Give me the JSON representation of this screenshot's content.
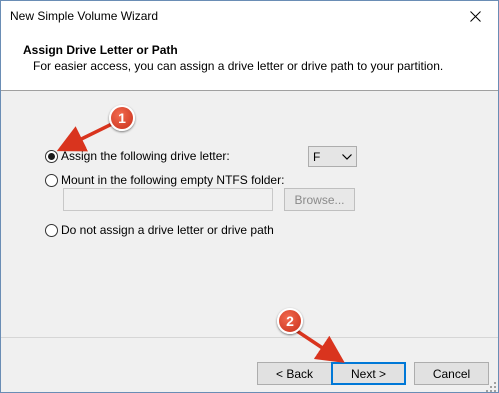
{
  "window": {
    "title": "New Simple Volume Wizard",
    "close_glyph": "✕"
  },
  "header": {
    "title": "Assign Drive Letter or Path",
    "subtitle": "For easier access, you can assign a drive letter or drive path to your partition."
  },
  "options": {
    "assign_letter": {
      "label": "Assign the following drive letter:",
      "checked": true
    },
    "mount_folder": {
      "label": "Mount in the following empty NTFS folder:",
      "checked": false
    },
    "no_letter": {
      "label": "Do not assign a drive letter or drive path",
      "checked": false
    }
  },
  "drive_letter": {
    "value": "F",
    "arrow_glyph": "⌄"
  },
  "folder_path": {
    "value": ""
  },
  "buttons": {
    "browse": "Browse...",
    "back": "< Back",
    "next": "Next >",
    "cancel": "Cancel"
  },
  "annotations": {
    "step1": "1",
    "step2": "2",
    "color": "#d9341e"
  }
}
